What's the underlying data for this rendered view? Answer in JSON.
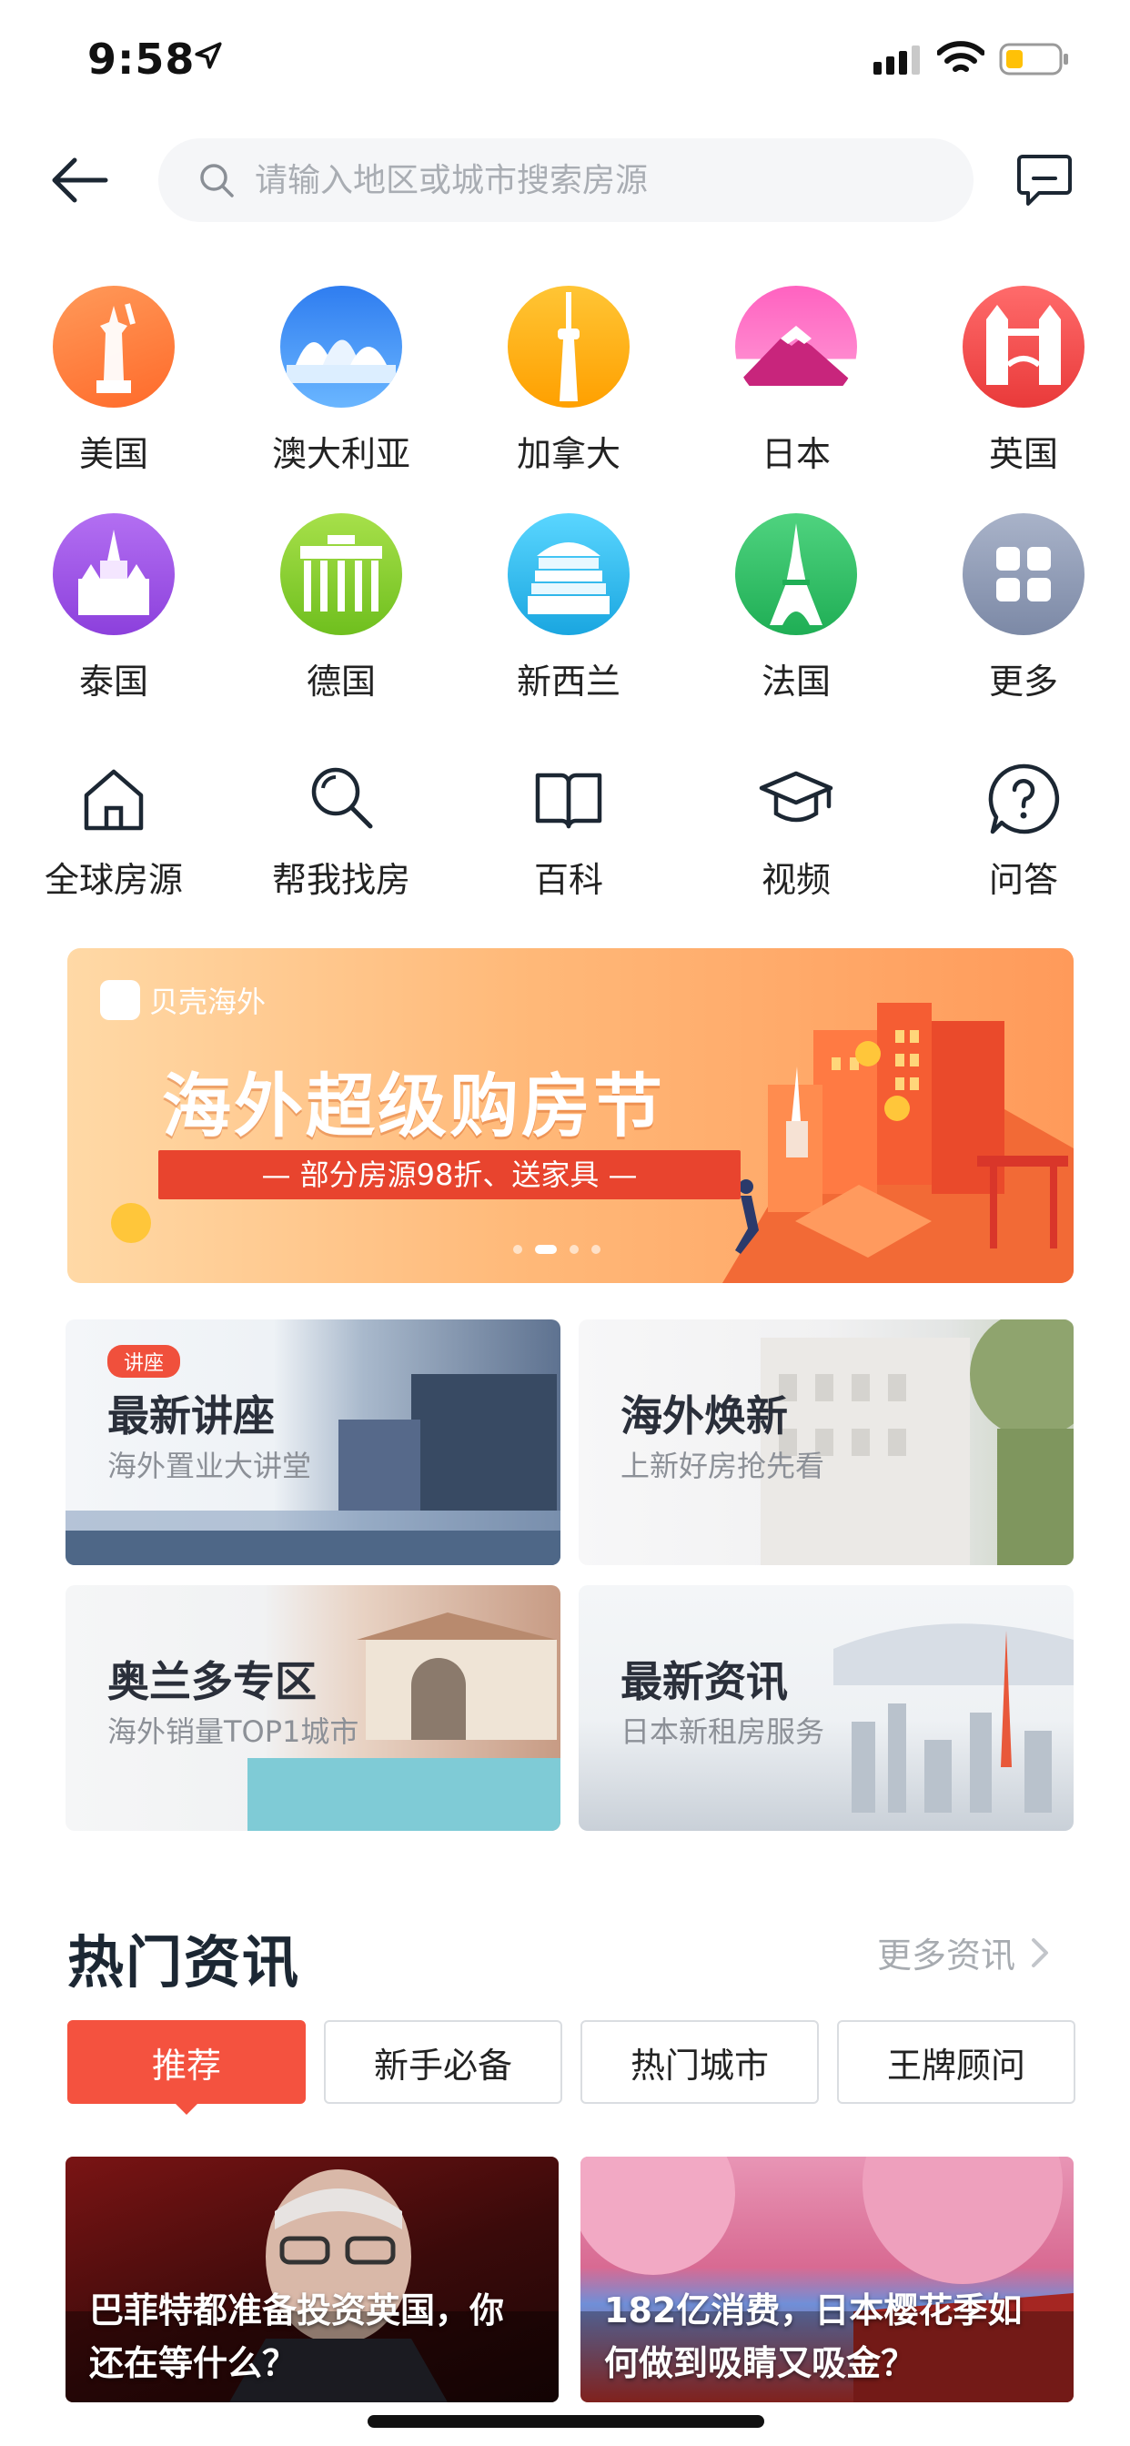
{
  "status_bar": {
    "time": "9:58"
  },
  "header": {
    "search_placeholder": "请输入地区或城市搜索房源"
  },
  "countries": [
    {
      "label": "美国",
      "icon": "statue-of-liberty-icon",
      "color": "#ff7a3c"
    },
    {
      "label": "澳大利亚",
      "icon": "sydney-opera-house-icon",
      "color": "#3a8ff0"
    },
    {
      "label": "加拿大",
      "icon": "cn-tower-icon",
      "color": "#ffb21a"
    },
    {
      "label": "日本",
      "icon": "mount-fuji-icon",
      "color": "#ff5ab4"
    },
    {
      "label": "英国",
      "icon": "tower-bridge-icon",
      "color": "#f24848"
    },
    {
      "label": "泰国",
      "icon": "thai-temple-icon",
      "color": "#a35ee8"
    },
    {
      "label": "德国",
      "icon": "brandenburg-gate-icon",
      "color": "#8cd12f"
    },
    {
      "label": "新西兰",
      "icon": "beehive-building-icon",
      "color": "#2ec4ee"
    },
    {
      "label": "法国",
      "icon": "eiffel-tower-icon",
      "color": "#33c46a"
    },
    {
      "label": "更多",
      "icon": "grid-more-icon",
      "color": "#8e9bb7"
    }
  ],
  "features": [
    {
      "label": "全球房源",
      "icon": "home-icon"
    },
    {
      "label": "帮我找房",
      "icon": "search-icon"
    },
    {
      "label": "百科",
      "icon": "book-icon"
    },
    {
      "label": "视频",
      "icon": "graduation-cap-icon"
    },
    {
      "label": "问答",
      "icon": "question-icon"
    }
  ],
  "banner": {
    "brand": "贝壳海外",
    "title": "海外超级购房节",
    "subtitle": "— 部分房源98折、送家具 —",
    "active_slide": 2,
    "slide_count": 4
  },
  "promo_cards": [
    {
      "tag": "讲座",
      "title": "最新讲座",
      "subtitle": "海外置业大讲堂"
    },
    {
      "title": "海外焕新",
      "subtitle": "上新好房抢先看"
    },
    {
      "title": "奥兰多专区",
      "subtitle": "海外销量TOP1城市"
    },
    {
      "title": "最新资讯",
      "subtitle": "日本新租房服务"
    }
  ],
  "hot_news": {
    "title": "热门资讯",
    "more_label": "更多资讯",
    "tabs": [
      "推荐",
      "新手必备",
      "热门城市",
      "王牌顾问"
    ],
    "active_tab": 0,
    "articles": [
      {
        "title": "巴菲特都准备投资英国，你还在等什么？"
      },
      {
        "title": "182亿消费，日本樱花季如何做到吸睛又吸金？"
      }
    ]
  },
  "colors": {
    "accent": "#f4523f",
    "banner_red": "#e8442e",
    "text_dark": "#1c2733"
  }
}
